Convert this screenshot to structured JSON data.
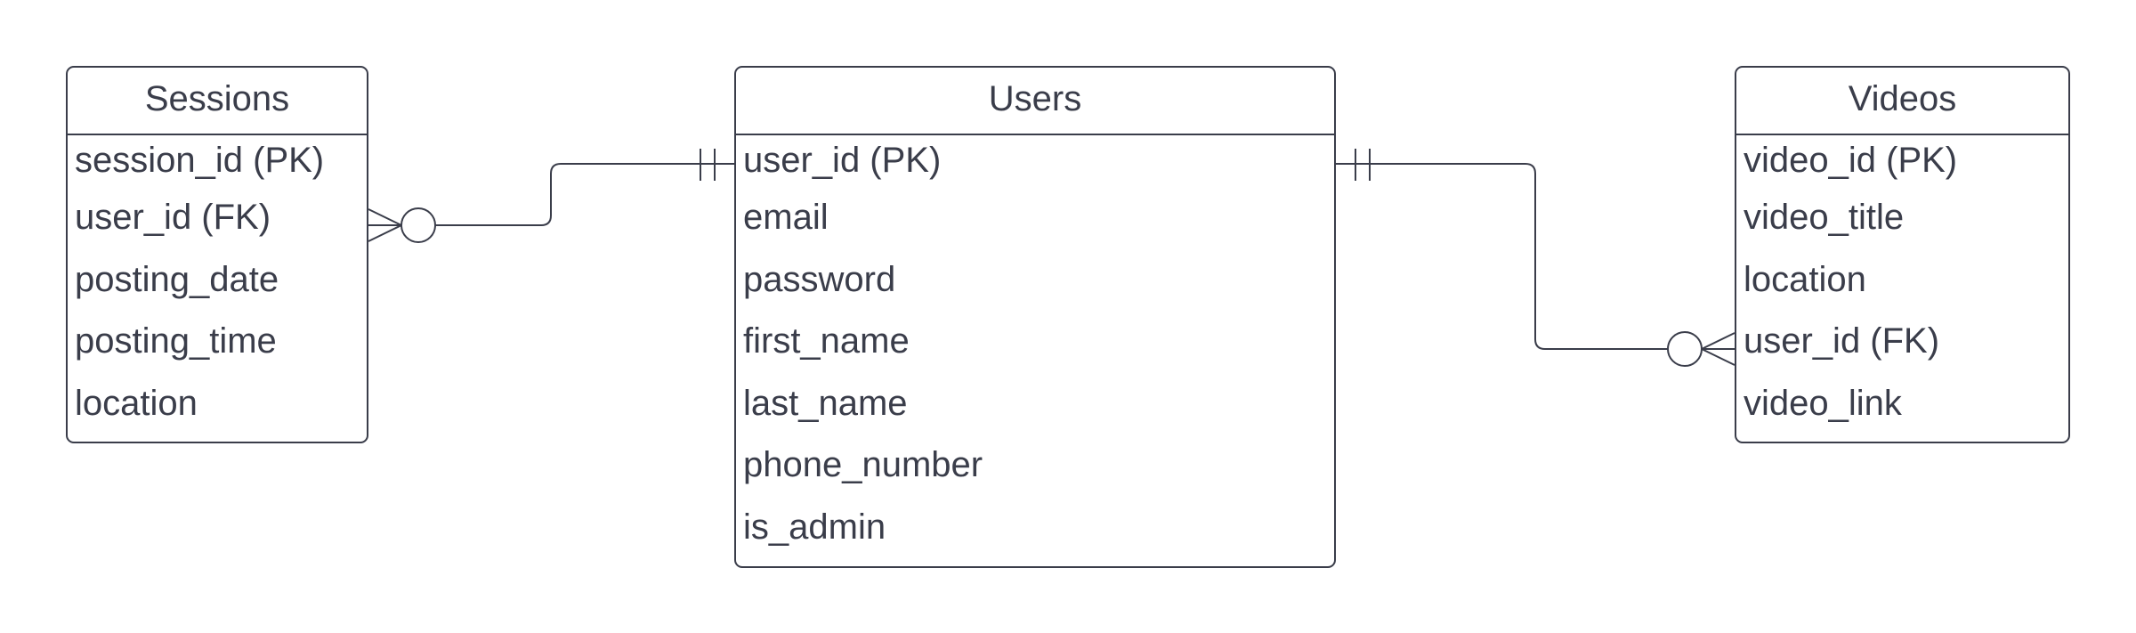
{
  "entities": {
    "sessions": {
      "title": "Sessions",
      "attributes": [
        "session_id (PK)",
        "user_id (FK)",
        "posting_date",
        "posting_time",
        "location"
      ]
    },
    "users": {
      "title": "Users",
      "attributes": [
        "user_id (PK)",
        "email",
        "password",
        "first_name",
        "last_name",
        "phone_number",
        "is_admin"
      ]
    },
    "videos": {
      "title": "Videos",
      "attributes": [
        "video_id (PK)",
        "video_title",
        "location",
        "user_id (FK)",
        "video_link"
      ]
    }
  },
  "relationships": [
    {
      "from": "users.user_id (PK)",
      "to": "sessions.user_id (FK)",
      "from_cardinality": "one-and-only-one",
      "to_cardinality": "zero-or-many"
    },
    {
      "from": "users.user_id (PK)",
      "to": "videos.user_id (FK)",
      "from_cardinality": "one-and-only-one",
      "to_cardinality": "zero-or-many"
    }
  ],
  "colors": {
    "stroke": "#3a3d4a",
    "background": "#ffffff",
    "text": "#3a3d4a"
  }
}
